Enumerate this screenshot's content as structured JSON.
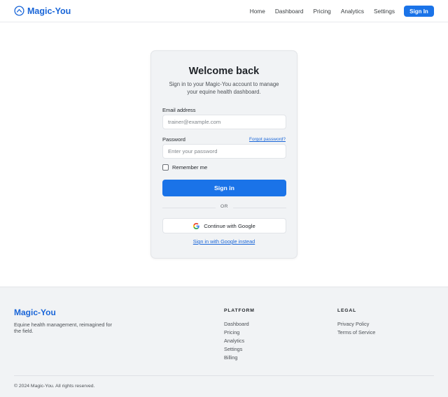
{
  "header": {
    "brand": "Magic-You",
    "brand_icon": "horseshoe-chevron-circle-icon",
    "nav": [
      {
        "label": "Home"
      },
      {
        "label": "Dashboard"
      },
      {
        "label": "Pricing"
      },
      {
        "label": "Analytics"
      },
      {
        "label": "Settings"
      }
    ],
    "signin_label": "Sign In"
  },
  "card": {
    "title": "Welcome back",
    "subtitle": "Sign in to your Magic-You account to manage your equine health dashboard.",
    "email": {
      "label": "Email address",
      "placeholder": "trainer@example.com",
      "value": ""
    },
    "password": {
      "label": "Password",
      "placeholder": "Enter your password",
      "value": "",
      "forgot_label": "Forgot password?"
    },
    "remember_label": "Remember me",
    "remember_checked": false,
    "submit_label": "Sign in",
    "divider_label": "OR",
    "google_label": "Continue with Google",
    "google_icon": "google-g-icon",
    "alt_link": "Sign in with Google instead"
  },
  "footer": {
    "brand": "Magic-You",
    "tagline": "Equine health management, reimagined for the field.",
    "platform": {
      "heading": "PLATFORM",
      "links": [
        "Dashboard",
        "Pricing",
        "Analytics",
        "Settings",
        "Billing"
      ]
    },
    "legal": {
      "heading": "LEGAL",
      "links": [
        "Privacy Policy",
        "Terms of Service"
      ]
    },
    "copyright": "© 2024 Magic-You. All rights reserved."
  },
  "colors": {
    "accent": "#1a73e8",
    "brand": "#1a66d8",
    "card_bg": "#f1f3f5",
    "footer_bg": "#f1f3f5"
  }
}
